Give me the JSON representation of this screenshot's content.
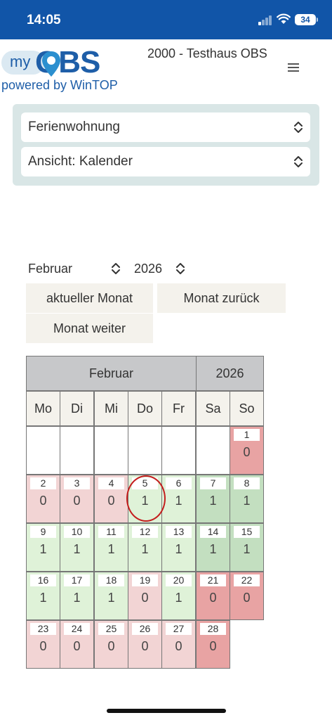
{
  "status_bar": {
    "time": "14:05",
    "battery": "34"
  },
  "header": {
    "logo_my": "my",
    "logo_obs": "OBS",
    "logo_powered": "powered by WinTOP",
    "title": "2000 - Testhaus OBS"
  },
  "selects": {
    "unit": "Ferienwohnung",
    "view": "Ansicht: Kalender"
  },
  "month_picker": {
    "month": "Februar",
    "year": "2026"
  },
  "buttons": {
    "current_month": "aktueller Monat",
    "month_back": "Monat zurück",
    "month_forward": "Monat weiter"
  },
  "calendar": {
    "header_month": "Februar",
    "header_year": "2026",
    "weekdays": [
      "Mo",
      "Di",
      "Mi",
      "Do",
      "Fr",
      "Sa",
      "So"
    ],
    "colors": {
      "weekday_free": "#dff2d8",
      "weekend_free": "#c3dfc0",
      "weekday_booked": "#f2d4d4",
      "weekend_booked": "#e8a3a3"
    },
    "days": [
      {
        "day": "1",
        "value": "0",
        "col": 6,
        "week": 0,
        "weekend": true
      },
      {
        "day": "2",
        "value": "0",
        "col": 0,
        "week": 1,
        "weekend": false
      },
      {
        "day": "3",
        "value": "0",
        "col": 1,
        "week": 1,
        "weekend": false
      },
      {
        "day": "4",
        "value": "0",
        "col": 2,
        "week": 1,
        "weekend": false
      },
      {
        "day": "5",
        "value": "1",
        "col": 3,
        "week": 1,
        "weekend": false
      },
      {
        "day": "6",
        "value": "1",
        "col": 4,
        "week": 1,
        "weekend": false
      },
      {
        "day": "7",
        "value": "1",
        "col": 5,
        "week": 1,
        "weekend": true
      },
      {
        "day": "8",
        "value": "1",
        "col": 6,
        "week": 1,
        "weekend": true
      },
      {
        "day": "9",
        "value": "1",
        "col": 0,
        "week": 2,
        "weekend": false
      },
      {
        "day": "10",
        "value": "1",
        "col": 1,
        "week": 2,
        "weekend": false
      },
      {
        "day": "11",
        "value": "1",
        "col": 2,
        "week": 2,
        "weekend": false
      },
      {
        "day": "12",
        "value": "1",
        "col": 3,
        "week": 2,
        "weekend": false
      },
      {
        "day": "13",
        "value": "1",
        "col": 4,
        "week": 2,
        "weekend": false
      },
      {
        "day": "14",
        "value": "1",
        "col": 5,
        "week": 2,
        "weekend": true
      },
      {
        "day": "15",
        "value": "1",
        "col": 6,
        "week": 2,
        "weekend": true
      },
      {
        "day": "16",
        "value": "1",
        "col": 0,
        "week": 3,
        "weekend": false
      },
      {
        "day": "17",
        "value": "1",
        "col": 1,
        "week": 3,
        "weekend": false
      },
      {
        "day": "18",
        "value": "1",
        "col": 2,
        "week": 3,
        "weekend": false
      },
      {
        "day": "19",
        "value": "0",
        "col": 3,
        "week": 3,
        "weekend": false
      },
      {
        "day": "20",
        "value": "1",
        "col": 4,
        "week": 3,
        "weekend": false
      },
      {
        "day": "21",
        "value": "0",
        "col": 5,
        "week": 3,
        "weekend": true
      },
      {
        "day": "22",
        "value": "0",
        "col": 6,
        "week": 3,
        "weekend": true
      },
      {
        "day": "23",
        "value": "0",
        "col": 0,
        "week": 4,
        "weekend": false
      },
      {
        "day": "24",
        "value": "0",
        "col": 1,
        "week": 4,
        "weekend": false
      },
      {
        "day": "25",
        "value": "0",
        "col": 2,
        "week": 4,
        "weekend": false
      },
      {
        "day": "26",
        "value": "0",
        "col": 3,
        "week": 4,
        "weekend": false
      },
      {
        "day": "27",
        "value": "0",
        "col": 4,
        "week": 4,
        "weekend": false
      },
      {
        "day": "28",
        "value": "0",
        "col": 5,
        "week": 4,
        "weekend": true
      }
    ]
  }
}
